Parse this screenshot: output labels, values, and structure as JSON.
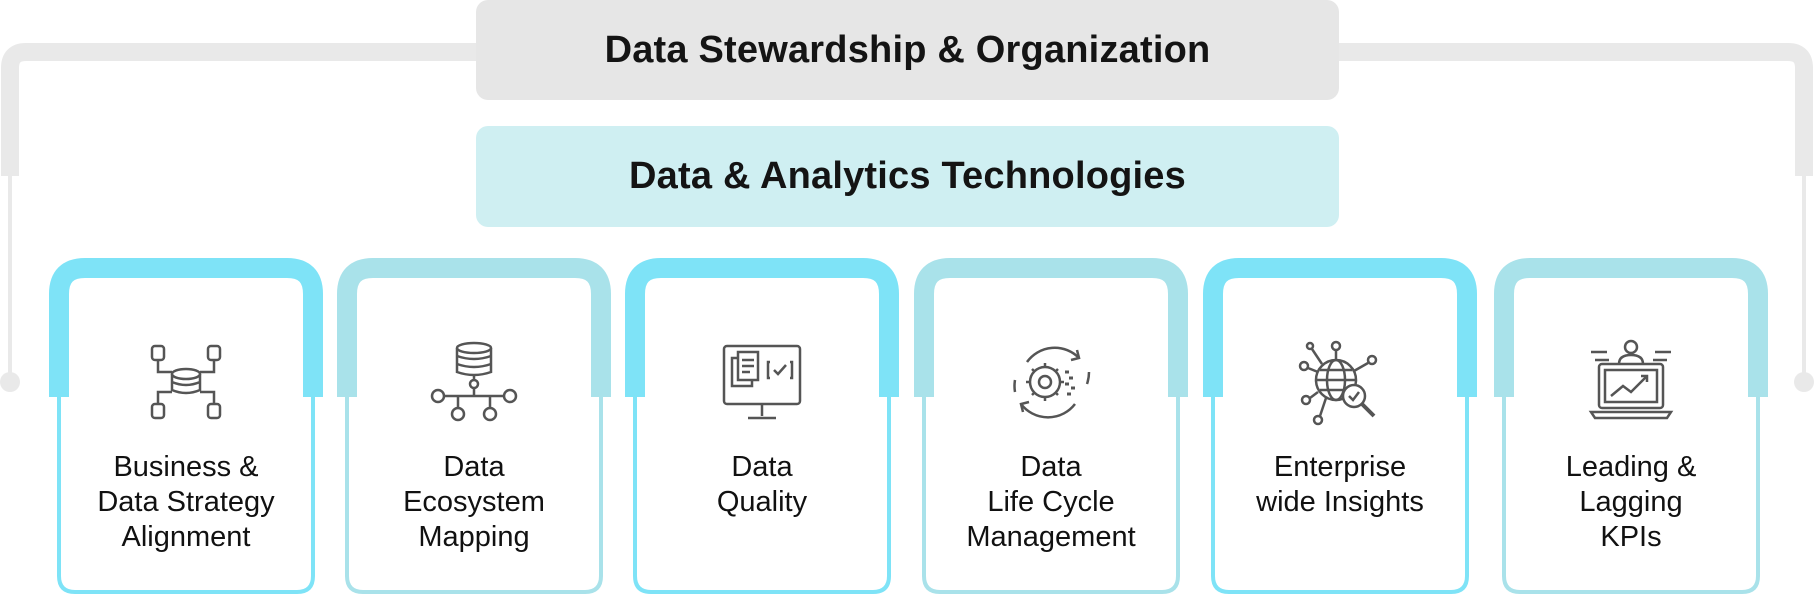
{
  "header": {
    "title": "Data Stewardship & Organization"
  },
  "subheader": {
    "title": "Data & Analytics Technologies"
  },
  "pillars": [
    {
      "lines": [
        "Business &",
        "Data Strategy",
        "Alignment"
      ],
      "icon": "database-network-icon",
      "accent": "#7ee3f7"
    },
    {
      "lines": [
        "Data",
        "Ecosystem",
        "Mapping"
      ],
      "icon": "data-hierarchy-icon",
      "accent": "#a9e2ea"
    },
    {
      "lines": [
        "Data",
        "Quality"
      ],
      "icon": "monitor-checklist-icon",
      "accent": "#7ee3f7"
    },
    {
      "lines": [
        "Data",
        "Life Cycle",
        "Management"
      ],
      "icon": "gear-cycle-icon",
      "accent": "#a9e2ea"
    },
    {
      "lines": [
        "Enterprise",
        "wide Insights"
      ],
      "icon": "globe-search-icon",
      "accent": "#7ee3f7"
    },
    {
      "lines": [
        "Leading &",
        "Lagging",
        "KPIs"
      ],
      "icon": "laptop-chart-icon",
      "accent": "#a9e2ea"
    }
  ],
  "colors": {
    "bracket": "#e9e9e9",
    "cyan": "#7ee3f7",
    "teal": "#a9e2ea",
    "icon": "#555555"
  }
}
